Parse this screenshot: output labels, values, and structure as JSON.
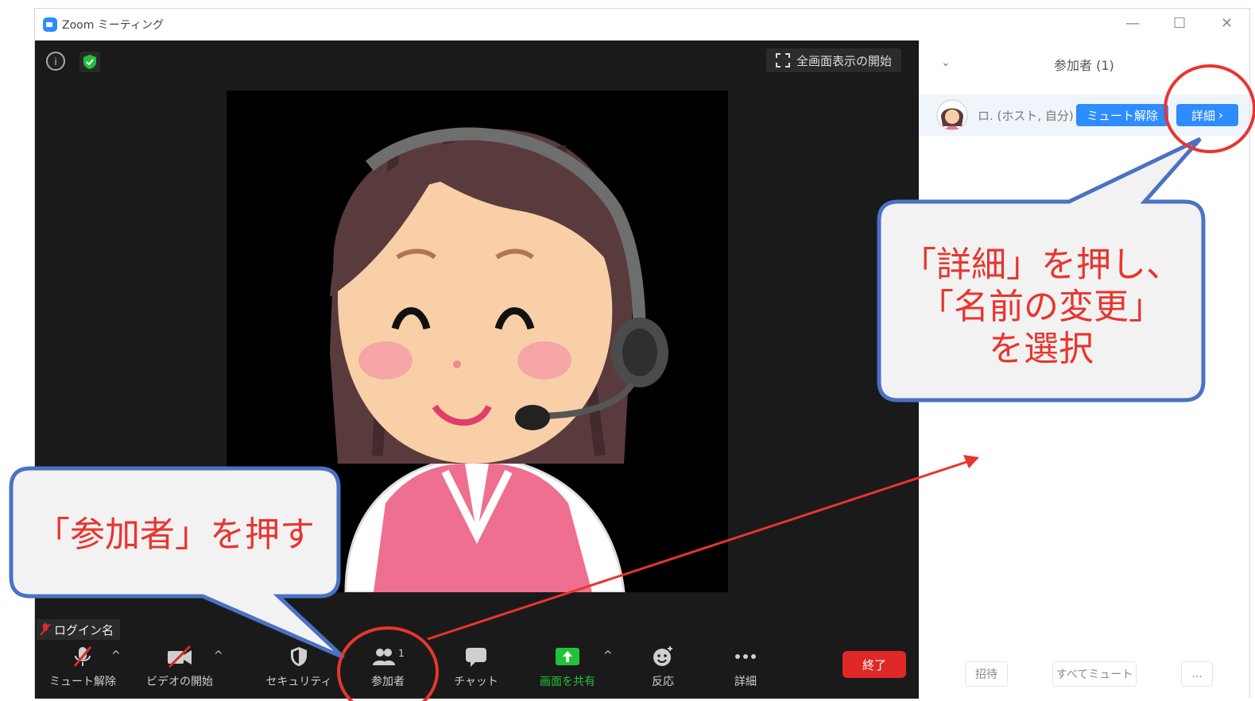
{
  "window": {
    "title": "Zoom ミーティング",
    "controls": {
      "minimize": "—",
      "maximize": "☐",
      "close": "✕"
    }
  },
  "video": {
    "fullscreen_label": "全画面表示の開始",
    "info_icon": "info-icon",
    "security_badge_icon": "shield-check-icon",
    "name_tag": "ログイン名"
  },
  "toolbar": {
    "items": [
      {
        "label": "ミュート解除",
        "icon": "mic-muted-icon"
      },
      {
        "label": "ビデオの開始",
        "icon": "video-off-icon"
      },
      {
        "label": "セキュリティ",
        "icon": "shield-icon"
      },
      {
        "label": "参加者",
        "icon": "participants-icon",
        "count": "1"
      },
      {
        "label": "チャット",
        "icon": "chat-icon"
      },
      {
        "label": "画面を共有",
        "icon": "share-screen-icon"
      },
      {
        "label": "反応",
        "icon": "reaction-icon"
      },
      {
        "label": "詳細",
        "icon": "more-icon"
      }
    ],
    "caret": "^",
    "end_label": "終了"
  },
  "panel": {
    "title": "参加者 (1)",
    "participant": {
      "name": "ロ. (ホスト, 自分)",
      "unmute_label": "ミュート解除",
      "detail_label": "詳細",
      "detail_chevron": "›"
    },
    "footer": {
      "invite": "招待",
      "mute_all": "すべてミュート",
      "more": "..."
    }
  },
  "annotations": {
    "callout_right": [
      "「詳細」を押し、",
      "「名前の変更」",
      "を選択"
    ],
    "callout_left": "「参加者」を押す",
    "colors": {
      "highlight_red": "#e8352e",
      "callout_border": "#4a72c4",
      "zoom_blue": "#2d8cff"
    }
  }
}
